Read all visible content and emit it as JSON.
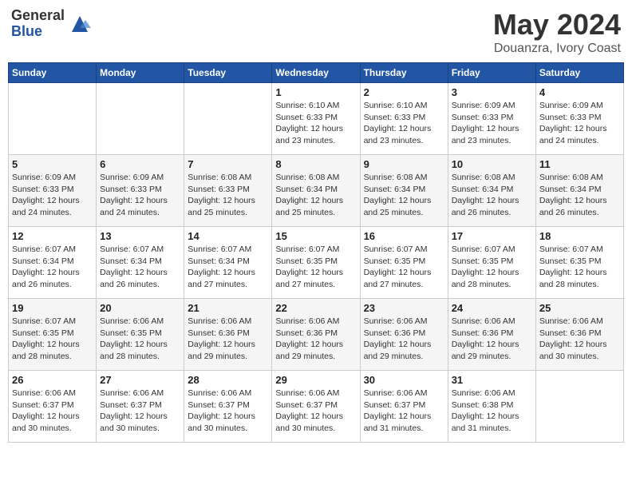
{
  "header": {
    "logo_general": "General",
    "logo_blue": "Blue",
    "month_title": "May 2024",
    "location": "Douanzra, Ivory Coast"
  },
  "weekdays": [
    "Sunday",
    "Monday",
    "Tuesday",
    "Wednesday",
    "Thursday",
    "Friday",
    "Saturday"
  ],
  "weeks": [
    [
      {
        "day": "",
        "info": ""
      },
      {
        "day": "",
        "info": ""
      },
      {
        "day": "",
        "info": ""
      },
      {
        "day": "1",
        "info": "Sunrise: 6:10 AM\nSunset: 6:33 PM\nDaylight: 12 hours\nand 23 minutes."
      },
      {
        "day": "2",
        "info": "Sunrise: 6:10 AM\nSunset: 6:33 PM\nDaylight: 12 hours\nand 23 minutes."
      },
      {
        "day": "3",
        "info": "Sunrise: 6:09 AM\nSunset: 6:33 PM\nDaylight: 12 hours\nand 23 minutes."
      },
      {
        "day": "4",
        "info": "Sunrise: 6:09 AM\nSunset: 6:33 PM\nDaylight: 12 hours\nand 24 minutes."
      }
    ],
    [
      {
        "day": "5",
        "info": "Sunrise: 6:09 AM\nSunset: 6:33 PM\nDaylight: 12 hours\nand 24 minutes."
      },
      {
        "day": "6",
        "info": "Sunrise: 6:09 AM\nSunset: 6:33 PM\nDaylight: 12 hours\nand 24 minutes."
      },
      {
        "day": "7",
        "info": "Sunrise: 6:08 AM\nSunset: 6:33 PM\nDaylight: 12 hours\nand 25 minutes."
      },
      {
        "day": "8",
        "info": "Sunrise: 6:08 AM\nSunset: 6:34 PM\nDaylight: 12 hours\nand 25 minutes."
      },
      {
        "day": "9",
        "info": "Sunrise: 6:08 AM\nSunset: 6:34 PM\nDaylight: 12 hours\nand 25 minutes."
      },
      {
        "day": "10",
        "info": "Sunrise: 6:08 AM\nSunset: 6:34 PM\nDaylight: 12 hours\nand 26 minutes."
      },
      {
        "day": "11",
        "info": "Sunrise: 6:08 AM\nSunset: 6:34 PM\nDaylight: 12 hours\nand 26 minutes."
      }
    ],
    [
      {
        "day": "12",
        "info": "Sunrise: 6:07 AM\nSunset: 6:34 PM\nDaylight: 12 hours\nand 26 minutes."
      },
      {
        "day": "13",
        "info": "Sunrise: 6:07 AM\nSunset: 6:34 PM\nDaylight: 12 hours\nand 26 minutes."
      },
      {
        "day": "14",
        "info": "Sunrise: 6:07 AM\nSunset: 6:34 PM\nDaylight: 12 hours\nand 27 minutes."
      },
      {
        "day": "15",
        "info": "Sunrise: 6:07 AM\nSunset: 6:35 PM\nDaylight: 12 hours\nand 27 minutes."
      },
      {
        "day": "16",
        "info": "Sunrise: 6:07 AM\nSunset: 6:35 PM\nDaylight: 12 hours\nand 27 minutes."
      },
      {
        "day": "17",
        "info": "Sunrise: 6:07 AM\nSunset: 6:35 PM\nDaylight: 12 hours\nand 28 minutes."
      },
      {
        "day": "18",
        "info": "Sunrise: 6:07 AM\nSunset: 6:35 PM\nDaylight: 12 hours\nand 28 minutes."
      }
    ],
    [
      {
        "day": "19",
        "info": "Sunrise: 6:07 AM\nSunset: 6:35 PM\nDaylight: 12 hours\nand 28 minutes."
      },
      {
        "day": "20",
        "info": "Sunrise: 6:06 AM\nSunset: 6:35 PM\nDaylight: 12 hours\nand 28 minutes."
      },
      {
        "day": "21",
        "info": "Sunrise: 6:06 AM\nSunset: 6:36 PM\nDaylight: 12 hours\nand 29 minutes."
      },
      {
        "day": "22",
        "info": "Sunrise: 6:06 AM\nSunset: 6:36 PM\nDaylight: 12 hours\nand 29 minutes."
      },
      {
        "day": "23",
        "info": "Sunrise: 6:06 AM\nSunset: 6:36 PM\nDaylight: 12 hours\nand 29 minutes."
      },
      {
        "day": "24",
        "info": "Sunrise: 6:06 AM\nSunset: 6:36 PM\nDaylight: 12 hours\nand 29 minutes."
      },
      {
        "day": "25",
        "info": "Sunrise: 6:06 AM\nSunset: 6:36 PM\nDaylight: 12 hours\nand 30 minutes."
      }
    ],
    [
      {
        "day": "26",
        "info": "Sunrise: 6:06 AM\nSunset: 6:37 PM\nDaylight: 12 hours\nand 30 minutes."
      },
      {
        "day": "27",
        "info": "Sunrise: 6:06 AM\nSunset: 6:37 PM\nDaylight: 12 hours\nand 30 minutes."
      },
      {
        "day": "28",
        "info": "Sunrise: 6:06 AM\nSunset: 6:37 PM\nDaylight: 12 hours\nand 30 minutes."
      },
      {
        "day": "29",
        "info": "Sunrise: 6:06 AM\nSunset: 6:37 PM\nDaylight: 12 hours\nand 30 minutes."
      },
      {
        "day": "30",
        "info": "Sunrise: 6:06 AM\nSunset: 6:37 PM\nDaylight: 12 hours\nand 31 minutes."
      },
      {
        "day": "31",
        "info": "Sunrise: 6:06 AM\nSunset: 6:38 PM\nDaylight: 12 hours\nand 31 minutes."
      },
      {
        "day": "",
        "info": ""
      }
    ]
  ]
}
